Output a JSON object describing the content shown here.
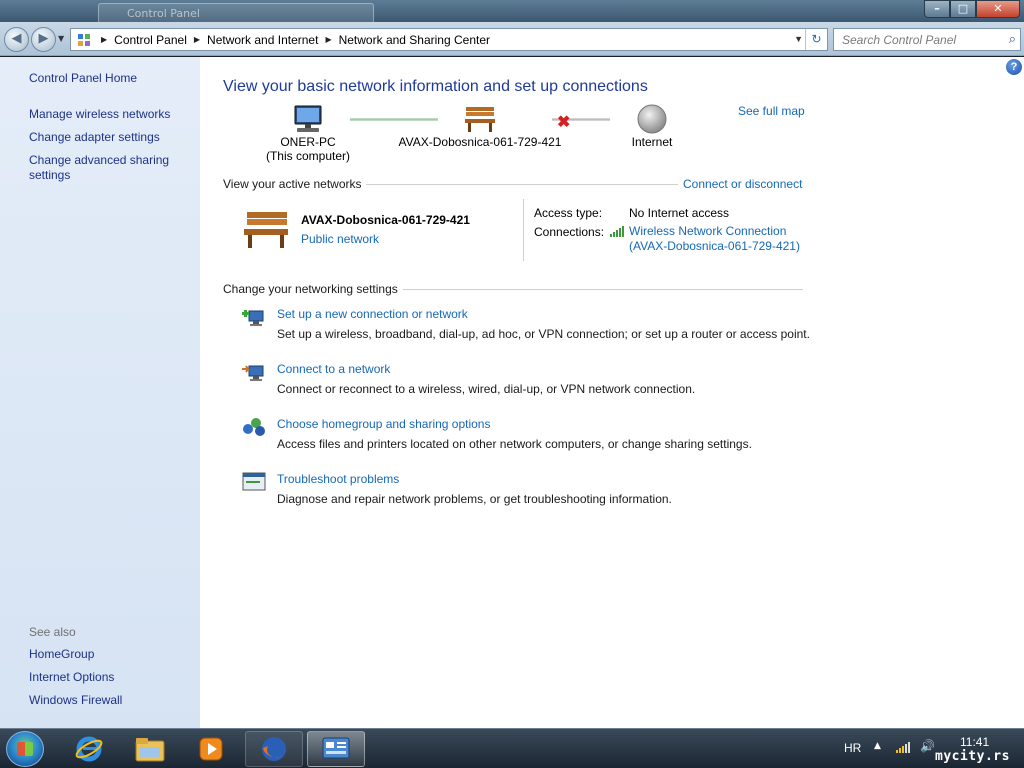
{
  "window": {
    "background_tab_title": "Control Panel",
    "minimize_label": "–",
    "maximize_label": "□",
    "close_label": "✕"
  },
  "address": {
    "crumbs": [
      "Control Panel",
      "Network and Internet",
      "Network and Sharing Center"
    ],
    "search_placeholder": "Search Control Panel"
  },
  "sidebar": {
    "home_link": "Control Panel Home",
    "links": [
      "Manage wireless networks",
      "Change adapter settings",
      "Change advanced sharing",
      "settings"
    ],
    "see_also_header": "See also",
    "see_also_links": [
      "HomeGroup",
      "Internet Options",
      "Windows Firewall"
    ]
  },
  "main": {
    "title": "View your basic network information and set up connections",
    "see_full_map": "See full map",
    "map": {
      "computer_name": "ONER-PC",
      "computer_sub": "(This computer)",
      "network_name": "AVAX-Dobosnica-061-729-421",
      "internet_label": "Internet"
    },
    "active_networks_header": "View your active networks",
    "connect_or_disconnect": "Connect or disconnect",
    "active_network": {
      "name": "AVAX-Dobosnica-061-729-421",
      "type": "Public network",
      "access_type_label": "Access type:",
      "access_type_value": "No Internet access",
      "connections_label": "Connections:",
      "connection_line1": "Wireless Network Connection",
      "connection_line2": "(AVAX-Dobosnica-061-729-421)"
    },
    "settings_header": "Change your networking settings",
    "tasks": [
      {
        "title": "Set up a new connection or network",
        "desc": "Set up a wireless, broadband, dial-up, ad hoc, or VPN connection; or set up a router or access point."
      },
      {
        "title": "Connect to a network",
        "desc": "Connect or reconnect to a wireless, wired, dial-up, or VPN network connection."
      },
      {
        "title": "Choose homegroup and sharing options",
        "desc": "Access files and printers located on other network computers, or change sharing settings."
      },
      {
        "title": "Troubleshoot problems",
        "desc": "Diagnose and repair network problems, or get troubleshooting information."
      }
    ],
    "help_label": "?"
  },
  "taskbar": {
    "language": "HR",
    "time": "11:41",
    "watermark": "mycity.rs"
  },
  "icons": {
    "error_mark": "✖",
    "tray_arrow": "▲",
    "volume": "🔊",
    "search": "⌕",
    "refresh": "↻"
  }
}
